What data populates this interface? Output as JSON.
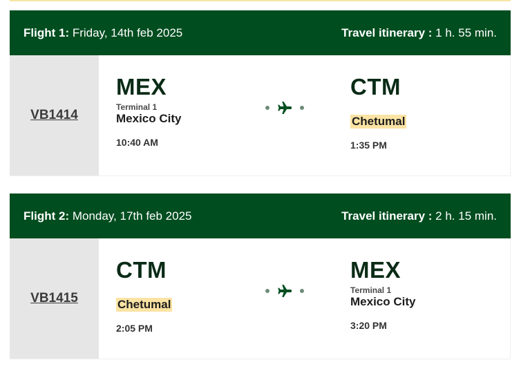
{
  "flights": [
    {
      "label": "Flight 1:",
      "date": "Friday, 14th feb 2025",
      "itinerary_label": "Travel itinerary :",
      "duration": "1 h. 55 min.",
      "flight_code": "VB1414",
      "origin": {
        "code": "MEX",
        "terminal": "Terminal 1",
        "city": "Mexico City",
        "time": "10:40 AM"
      },
      "destination": {
        "code": "CTM",
        "terminal": "",
        "city": "Chetumal",
        "time": "1:35 PM"
      }
    },
    {
      "label": "Flight 2:",
      "date": "Monday, 17th feb 2025",
      "itinerary_label": "Travel itinerary :",
      "duration": "2 h. 15 min.",
      "flight_code": "VB1415",
      "origin": {
        "code": "CTM",
        "terminal": "",
        "city": "Chetumal",
        "time": "2:05 PM"
      },
      "destination": {
        "code": "MEX",
        "terminal": "Terminal 1",
        "city": "Mexico City",
        "time": "3:20 PM"
      }
    }
  ],
  "icons": {
    "connector": "airplane-icon"
  },
  "colors": {
    "header_bg": "#004d1f",
    "highlight": "#fbe3a3",
    "code_panel": "#e6e6e6"
  }
}
